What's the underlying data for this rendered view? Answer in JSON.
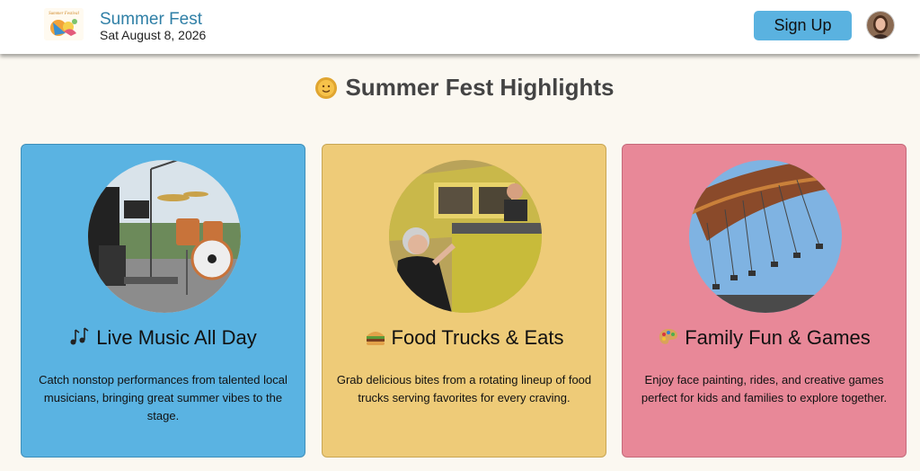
{
  "header": {
    "logo_text": "Summer Festival",
    "event_name": "Summer Fest",
    "event_date": "Sat August 8, 2026",
    "signup_label": "Sign Up"
  },
  "main": {
    "title": "Summer Fest Highlights",
    "title_icon": "sun-icon",
    "cards": [
      {
        "icon": "music-notes-icon",
        "title": "Live Music All Day",
        "description": "Catch nonstop performances from talented local musicians, bringing great summer vibes to the stage.",
        "color": "#5ab3e2"
      },
      {
        "icon": "burger-icon",
        "title": "Food Trucks & Eats",
        "description": "Grab delicious bites from a rotating lineup of food trucks serving favorites for every craving.",
        "color": "#eecb78"
      },
      {
        "icon": "palette-icon",
        "title": "Family Fun & Games",
        "description": "Enjoy face painting, rides, and creative games perfect for kids and families to explore together.",
        "color": "#e88898"
      }
    ]
  },
  "colors": {
    "accent": "#5ab2e0",
    "brand_text": "#2f7fa6",
    "page_background": "#fbf8f1"
  }
}
